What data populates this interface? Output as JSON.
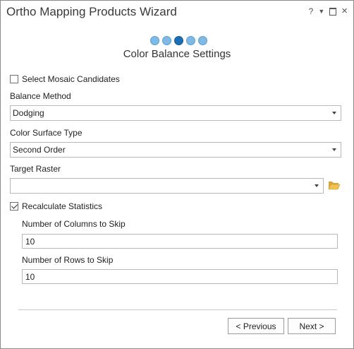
{
  "window": {
    "title": "Ortho Mapping Products Wizard",
    "controls": {
      "help": "?",
      "menu": "▼",
      "restore": "",
      "close": "×"
    }
  },
  "wizard": {
    "step_count": 5,
    "active_step": 3,
    "page_title": "Color Balance Settings"
  },
  "form": {
    "select_mosaic_candidates": {
      "label": "Select Mosaic Candidates",
      "checked": false
    },
    "balance_method": {
      "label": "Balance Method",
      "value": "Dodging"
    },
    "color_surface_type": {
      "label": "Color Surface Type",
      "value": "Second Order"
    },
    "target_raster": {
      "label": "Target Raster",
      "value": ""
    },
    "recalculate_statistics": {
      "label": "Recalculate Statistics",
      "checked": true
    },
    "columns_to_skip": {
      "label": "Number of Columns to Skip",
      "value": "10"
    },
    "rows_to_skip": {
      "label": "Number of Rows to Skip",
      "value": "10"
    }
  },
  "footer": {
    "previous_label": "< Previous",
    "next_label": "Next >"
  },
  "colors": {
    "step_dot": "#7fb9e4",
    "step_dot_active": "#1c6fb2",
    "folder_icon": "#e8b84a"
  }
}
